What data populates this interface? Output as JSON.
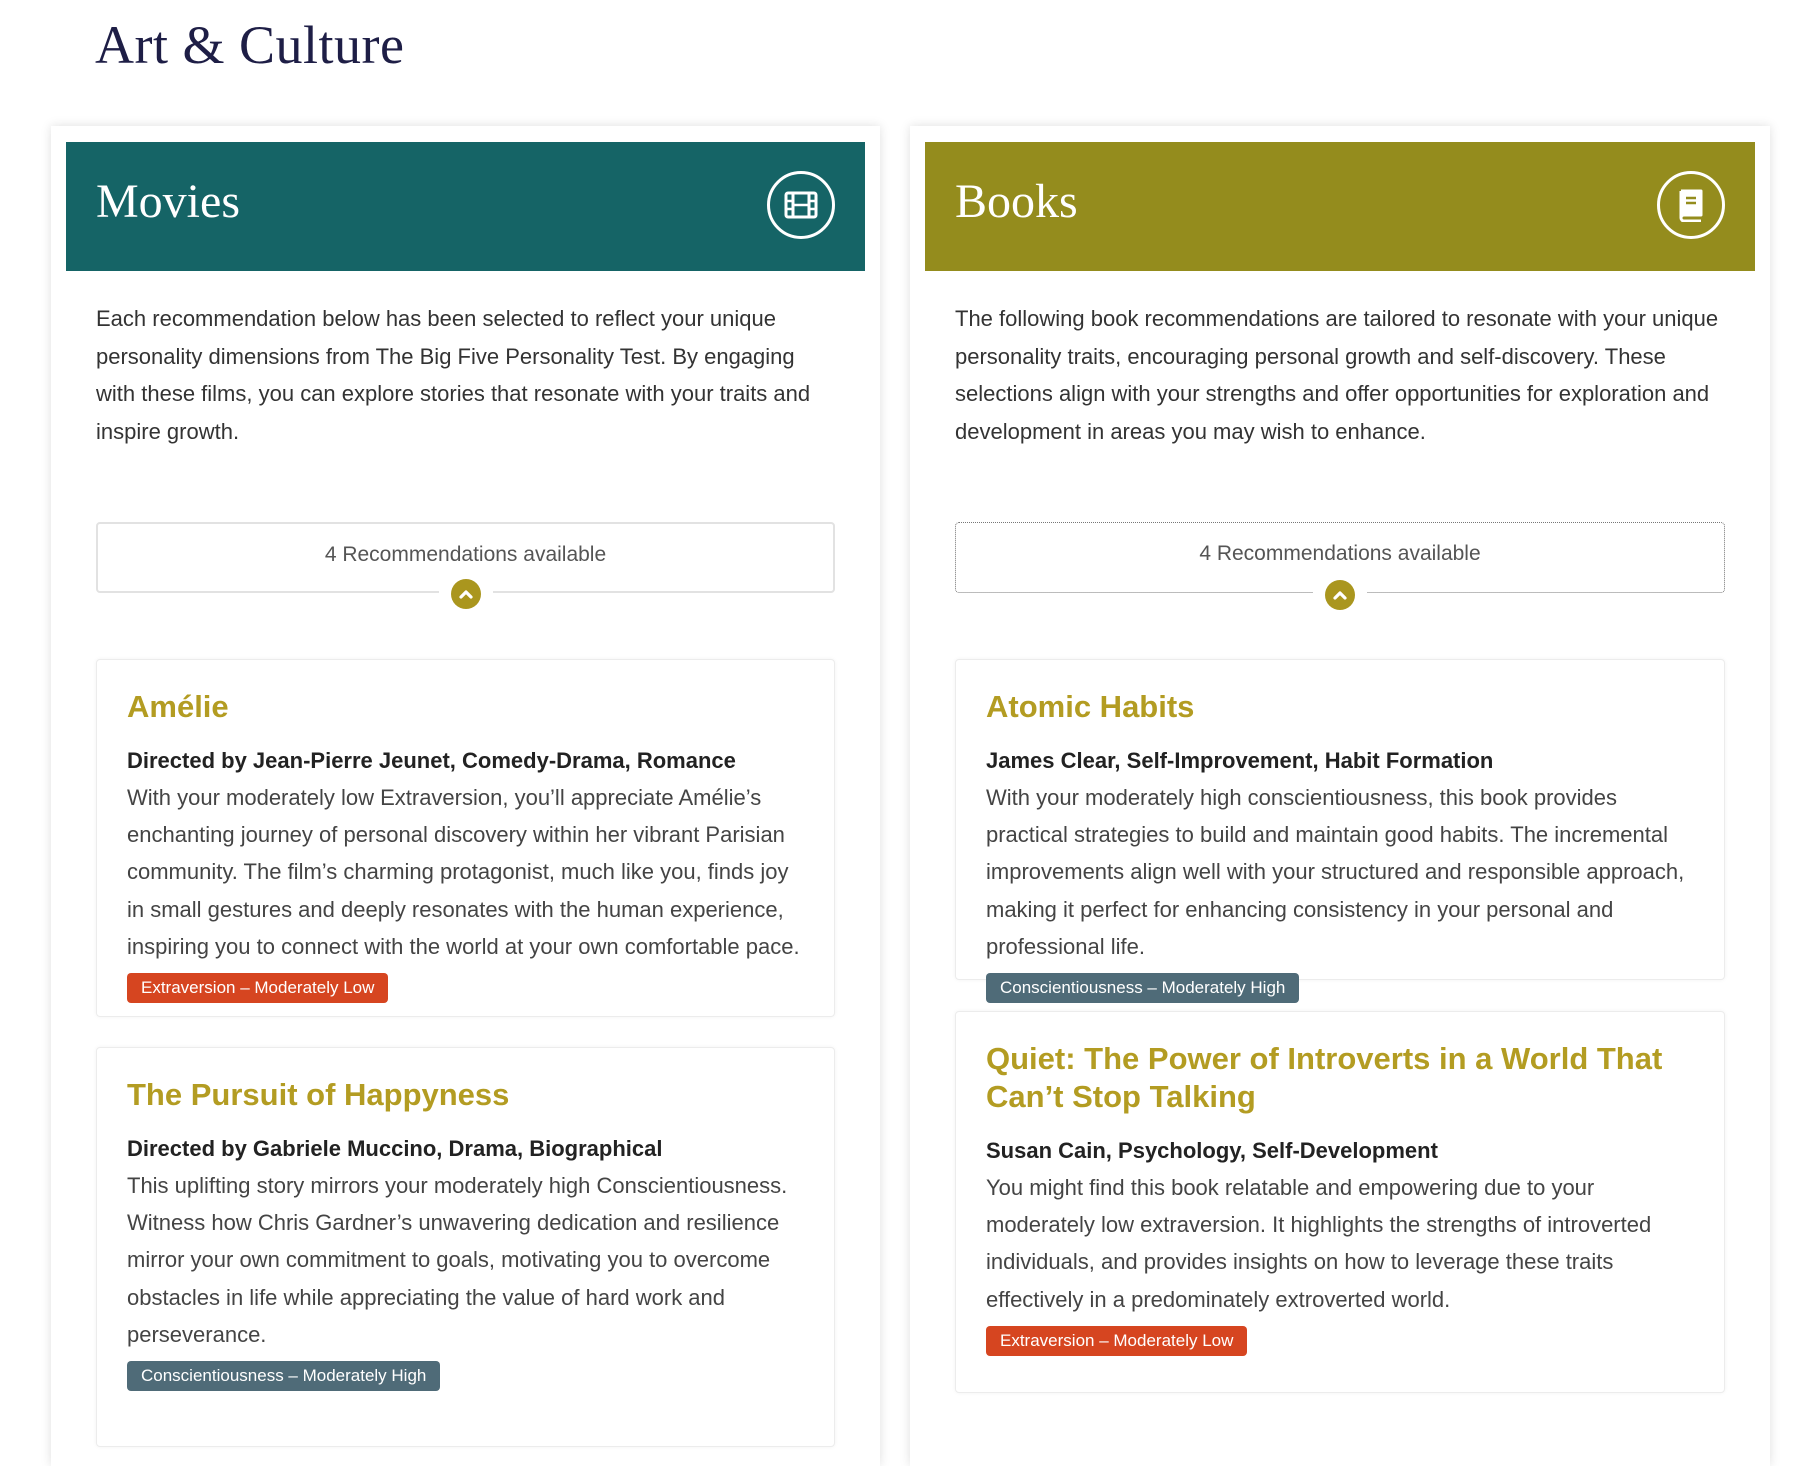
{
  "page": {
    "title": "Art & Culture"
  },
  "movies": {
    "title": "Movies",
    "icon": "film-icon",
    "intro": "Each recommendation below has been selected to reflect your unique personality dimensions from The Big Five Personality Test. By engaging with these films, you can explore stories that resonate with your traits and inspire growth.",
    "recommendations_label": "4 Recommendations available",
    "items": [
      {
        "title": "Amélie",
        "meta": "Directed by Jean-Pierre Jeunet, Comedy-Drama, Romance",
        "description": "With your moderately low Extraversion, you’ll appreciate Amélie’s enchanting journey of personal discovery within her vibrant Parisian community. The film’s charming protagonist, much like you, finds joy in small gestures and deeply resonates with the human experience, inspiring you to connect with the world at your own comfortable pace.",
        "badge": "Extraversion – Moderately Low",
        "badge_color": "#d64520"
      },
      {
        "title": "The Pursuit of Happyness",
        "meta": "Directed by Gabriele Muccino, Drama, Biographical",
        "description": "This uplifting story mirrors your moderately high Conscientiousness. Witness how Chris Gardner’s unwavering dedication and resilience mirror your own commitment to goals, motivating you to overcome obstacles in life while appreciating the value of hard work and perseverance.",
        "badge": "Conscientiousness – Moderately High",
        "badge_color": "#4f6b78"
      }
    ]
  },
  "books": {
    "title": "Books",
    "icon": "book-icon",
    "intro": "The following book recommendations are tailored to resonate with your unique personality traits, encouraging personal growth and self-discovery. These selections align with your strengths and offer opportunities for exploration and development in areas you may wish to enhance.",
    "recommendations_label": "4 Recommendations available",
    "items": [
      {
        "title": "Atomic Habits",
        "meta": "James Clear, Self-Improvement, Habit Formation",
        "description": "With your moderately high conscientiousness, this book provides practical strategies to build and maintain good habits. The incremental improvements align well with your structured and responsible approach, making it perfect for enhancing consistency in your personal and professional life.",
        "badge": "Conscientiousness – Moderately High",
        "badge_color": "#4f6b78"
      },
      {
        "title": "Quiet: The Power of Introverts in a World That Can’t Stop Talking",
        "meta": "Susan Cain, Psychology, Self-Development",
        "description": "You might find this book relatable and empowering due to your moderately low extraversion. It highlights the strengths of introverted individuals, and provides insights on how to leverage these traits effectively in a predominately extroverted world.",
        "badge": "Extraversion – Moderately Low",
        "badge_color": "#d64520"
      }
    ]
  },
  "colors": {
    "movies_header": "#156466",
    "books_header": "#948c1d",
    "card_title": "#b39c22",
    "chevron": "#aa961e",
    "page_title": "#1e1e46"
  }
}
